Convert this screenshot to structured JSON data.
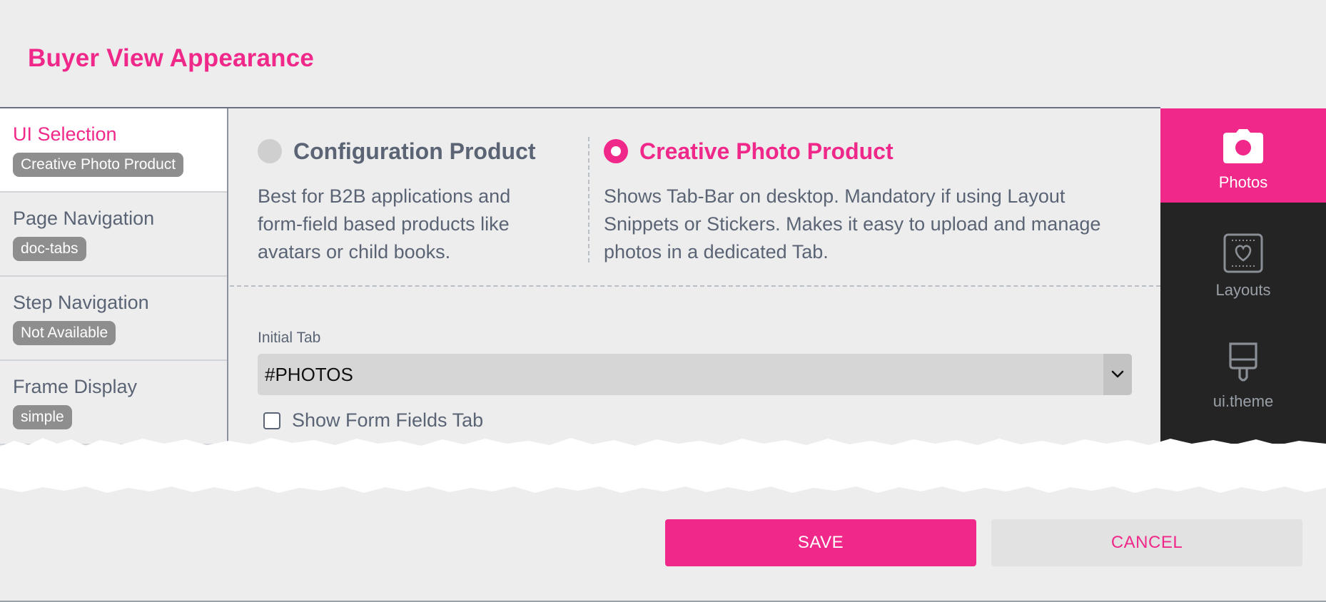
{
  "page_title": "Buyer View Appearance",
  "sidebar": {
    "items": [
      {
        "label": "UI Selection",
        "badge": "Creative Photo Product",
        "active": true
      },
      {
        "label": "Page Navigation",
        "badge": "doc-tabs",
        "active": false
      },
      {
        "label": "Step Navigation",
        "badge": "Not Available",
        "active": false
      },
      {
        "label": "Frame Display",
        "badge": "simple",
        "active": false
      }
    ]
  },
  "options": [
    {
      "title": "Configuration Product",
      "description": "Best for B2B applications and form-field based products like avatars or child books.",
      "selected": false
    },
    {
      "title": "Creative Photo Product",
      "description": "Shows Tab-Bar on desktop. Mandatory if using Layout Snippets or Stickers. Makes it easy to upload and manage photos in a dedicated Tab.",
      "selected": true
    }
  ],
  "initial_tab": {
    "label": "Initial Tab",
    "value": "#PHOTOS"
  },
  "show_form_fields": {
    "label": "Show Form Fields Tab",
    "checked": false
  },
  "tabbar": {
    "tabs": [
      {
        "label": "Photos",
        "icon": "camera-icon",
        "active": true
      },
      {
        "label": "Layouts",
        "icon": "layout-heart-icon",
        "active": false
      },
      {
        "label": "ui.theme",
        "icon": "paint-brush-icon",
        "active": false
      }
    ]
  },
  "actions": {
    "save_label": "SAVE",
    "cancel_label": "CANCEL"
  },
  "colors": {
    "accent": "#f0288a",
    "tabbar_bg": "#242424",
    "badge_bg": "#8e8e8e"
  }
}
